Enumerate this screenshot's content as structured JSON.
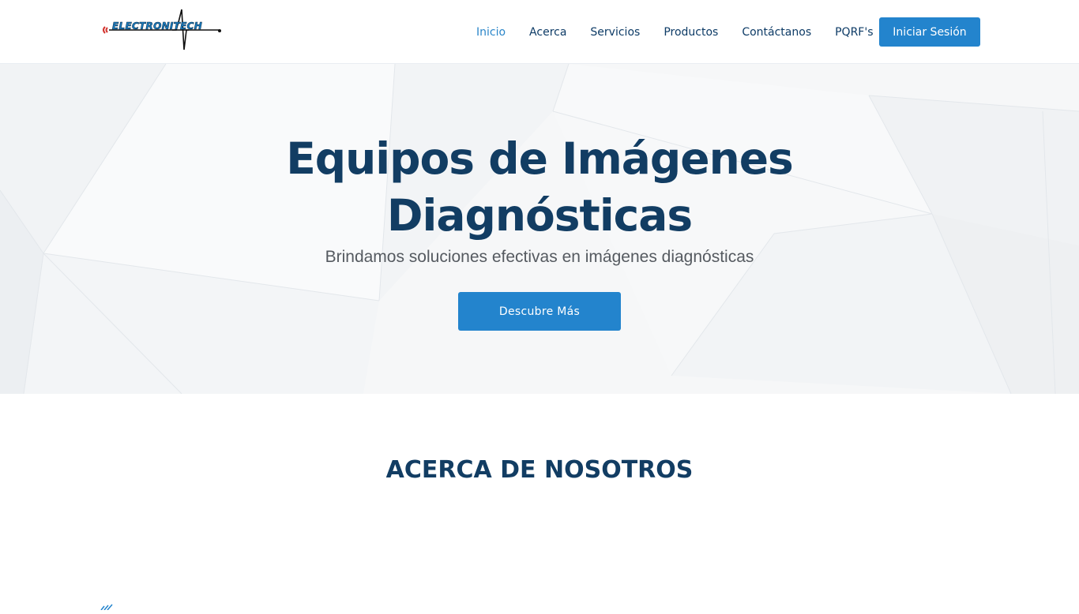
{
  "brand": {
    "logo_text": "ELECTRONITECH",
    "colors": {
      "primary": "#2384cd",
      "heading": "#123d63",
      "accent_red": "#d3342f"
    }
  },
  "nav": {
    "items": [
      {
        "label": "Inicio",
        "active": true
      },
      {
        "label": "Acerca",
        "active": false
      },
      {
        "label": "Servicios",
        "active": false
      },
      {
        "label": "Productos",
        "active": false
      },
      {
        "label": "Contáctanos",
        "active": false
      },
      {
        "label": "PQRF's",
        "active": false
      }
    ],
    "login_label": "Iniciar Sesión"
  },
  "hero": {
    "title_line1": "Equipos de Imágenes",
    "title_line2": "Diagnósticas",
    "subtitle": "Brindamos soluciones efectivas en imágenes diagnósticas",
    "cta_label": "Descubre Más"
  },
  "about": {
    "title": "ACERCA DE NOSOTROS"
  },
  "icons": [
    "logo-icon",
    "signal-waves-icon"
  ]
}
